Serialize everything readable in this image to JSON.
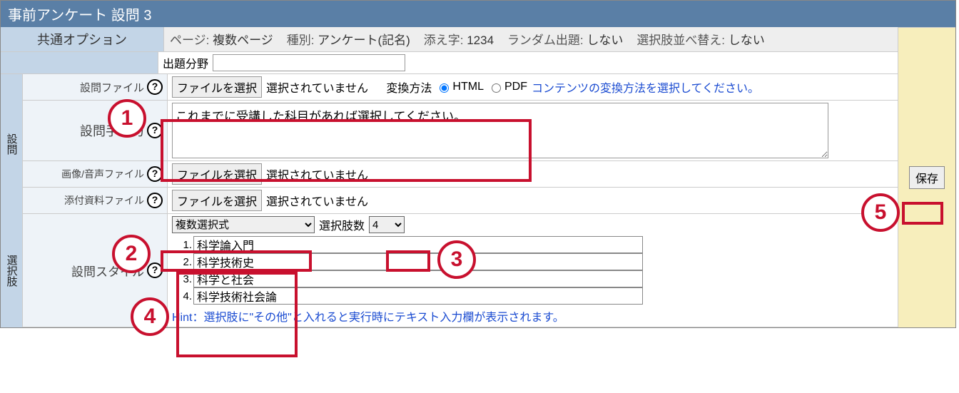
{
  "title": "事前アンケート  設問 3",
  "common_options": {
    "label": "共通オプション",
    "page_lbl": "ページ:",
    "page_val": "複数ページ",
    "type_lbl": "種別:",
    "type_val": "アンケート(記名)",
    "soeji_lbl": "添え字:",
    "soeji_val": "1234",
    "random_lbl": "ランダム出題:",
    "random_val": "しない",
    "shuffle_lbl": "選択肢並べ替え:",
    "shuffle_val": "しない"
  },
  "field_row": {
    "label": "出題分野",
    "value": ""
  },
  "question": {
    "vtab": "設問",
    "file_label": "設問ファイル",
    "choose_file": "ファイルを選択",
    "no_file": "選択されていません",
    "convert_label": "変換方法",
    "convert_html": "HTML",
    "convert_pdf": "PDF",
    "convert_link": "コンテンツの変換方法を選択してください。",
    "manual_label": "設問手入力",
    "manual_value": "これまでに受講した科目があれば選択してください。",
    "media_label": "画像/音声ファイル",
    "attach_label": "添付資料ファイル"
  },
  "choices": {
    "vtab": "選択肢",
    "style_label": "設問スタイル",
    "style_value": "複数選択式",
    "count_label": "選択肢数",
    "count_value": "4",
    "items": [
      "科学論入門",
      "科学技術史",
      "科学と社会",
      "科学技術社会論"
    ],
    "hint": "Hint：選択肢に\"その他\"と入れると実行時にテキスト入力欄が表示されます。"
  },
  "save": "保存",
  "annotations": {
    "1": "1",
    "2": "2",
    "3": "3",
    "4": "4",
    "5": "5"
  }
}
